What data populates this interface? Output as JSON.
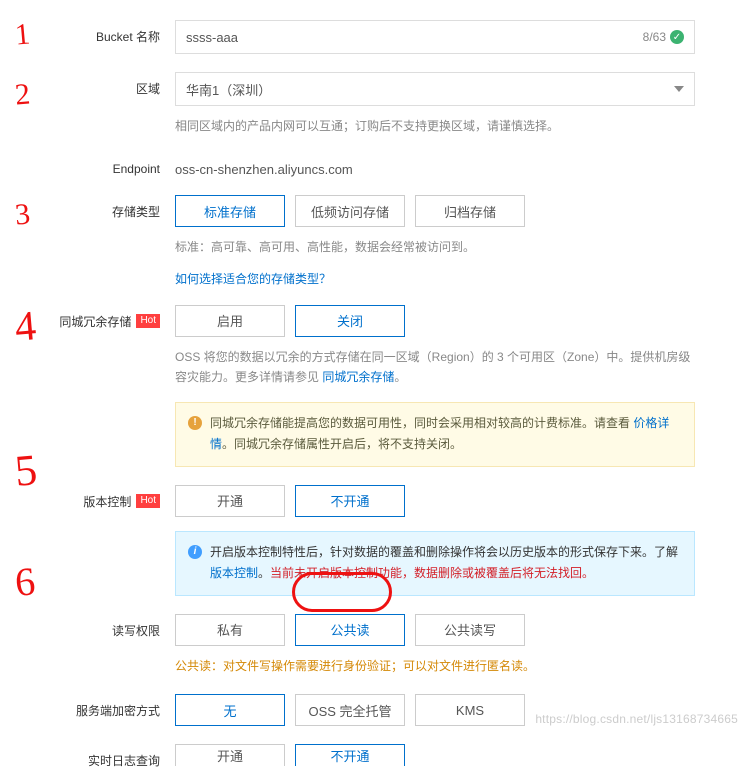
{
  "bucket": {
    "label": "Bucket 名称",
    "value": "ssss-aaa",
    "count": "8/63"
  },
  "region": {
    "label": "区域",
    "value": "华南1（深圳）",
    "hint": "相同区域内的产品内网可以互通；订购后不支持更换区域，请谨慎选择。"
  },
  "endpoint": {
    "label": "Endpoint",
    "value": "oss-cn-shenzhen.aliyuncs.com"
  },
  "storage": {
    "label": "存储类型",
    "opts": [
      "标准存储",
      "低频访问存储",
      "归档存储"
    ],
    "hint": "标准：高可靠、高可用、高性能，数据会经常被访问到。",
    "link": "如何选择适合您的存储类型？"
  },
  "redundancy": {
    "label": "同城冗余存储",
    "badge": "Hot",
    "opts": [
      "启用",
      "关闭"
    ],
    "hint_pre": "OSS 将您的数据以冗余的方式存储在同一区域（Region）的 3 个可用区（Zone）中。提供机房级容灾能力。更多详情请参见 ",
    "hint_link": "同城冗余存储",
    "hint_post": "。",
    "alert_pre": "同城冗余存储能提高您的数据可用性，同时会采用相对较高的计费标准。请查看 ",
    "alert_link": "价格详情",
    "alert_post": "。同城冗余存储属性开启后，将不支持关闭。"
  },
  "version": {
    "label": "版本控制",
    "badge": "Hot",
    "opts": [
      "开通",
      "不开通"
    ],
    "alert_pre": "开启版本控制特性后，针对数据的覆盖和删除操作将会以历史版本的形式保存下来。了解 ",
    "alert_link": "版本控制",
    "alert_mid": "。",
    "alert_red": "当前未开启版本控制功能，数据删除或被覆盖后将无法找回。"
  },
  "acl": {
    "label": "读写权限",
    "opts": [
      "私有",
      "公共读",
      "公共读写"
    ],
    "hint": "公共读：对文件写操作需要进行身份验证；可以对文件进行匿名读。"
  },
  "encryption": {
    "label": "服务端加密方式",
    "opts": [
      "无",
      "OSS 完全托管",
      "KMS"
    ]
  },
  "logs": {
    "label": "实时日志查询",
    "opts": [
      "开通",
      "不开通"
    ]
  },
  "watermark": "https://blog.csdn.net/ljs13168734665",
  "annotations": [
    "1",
    "2",
    "3",
    "4",
    "5",
    "6"
  ]
}
